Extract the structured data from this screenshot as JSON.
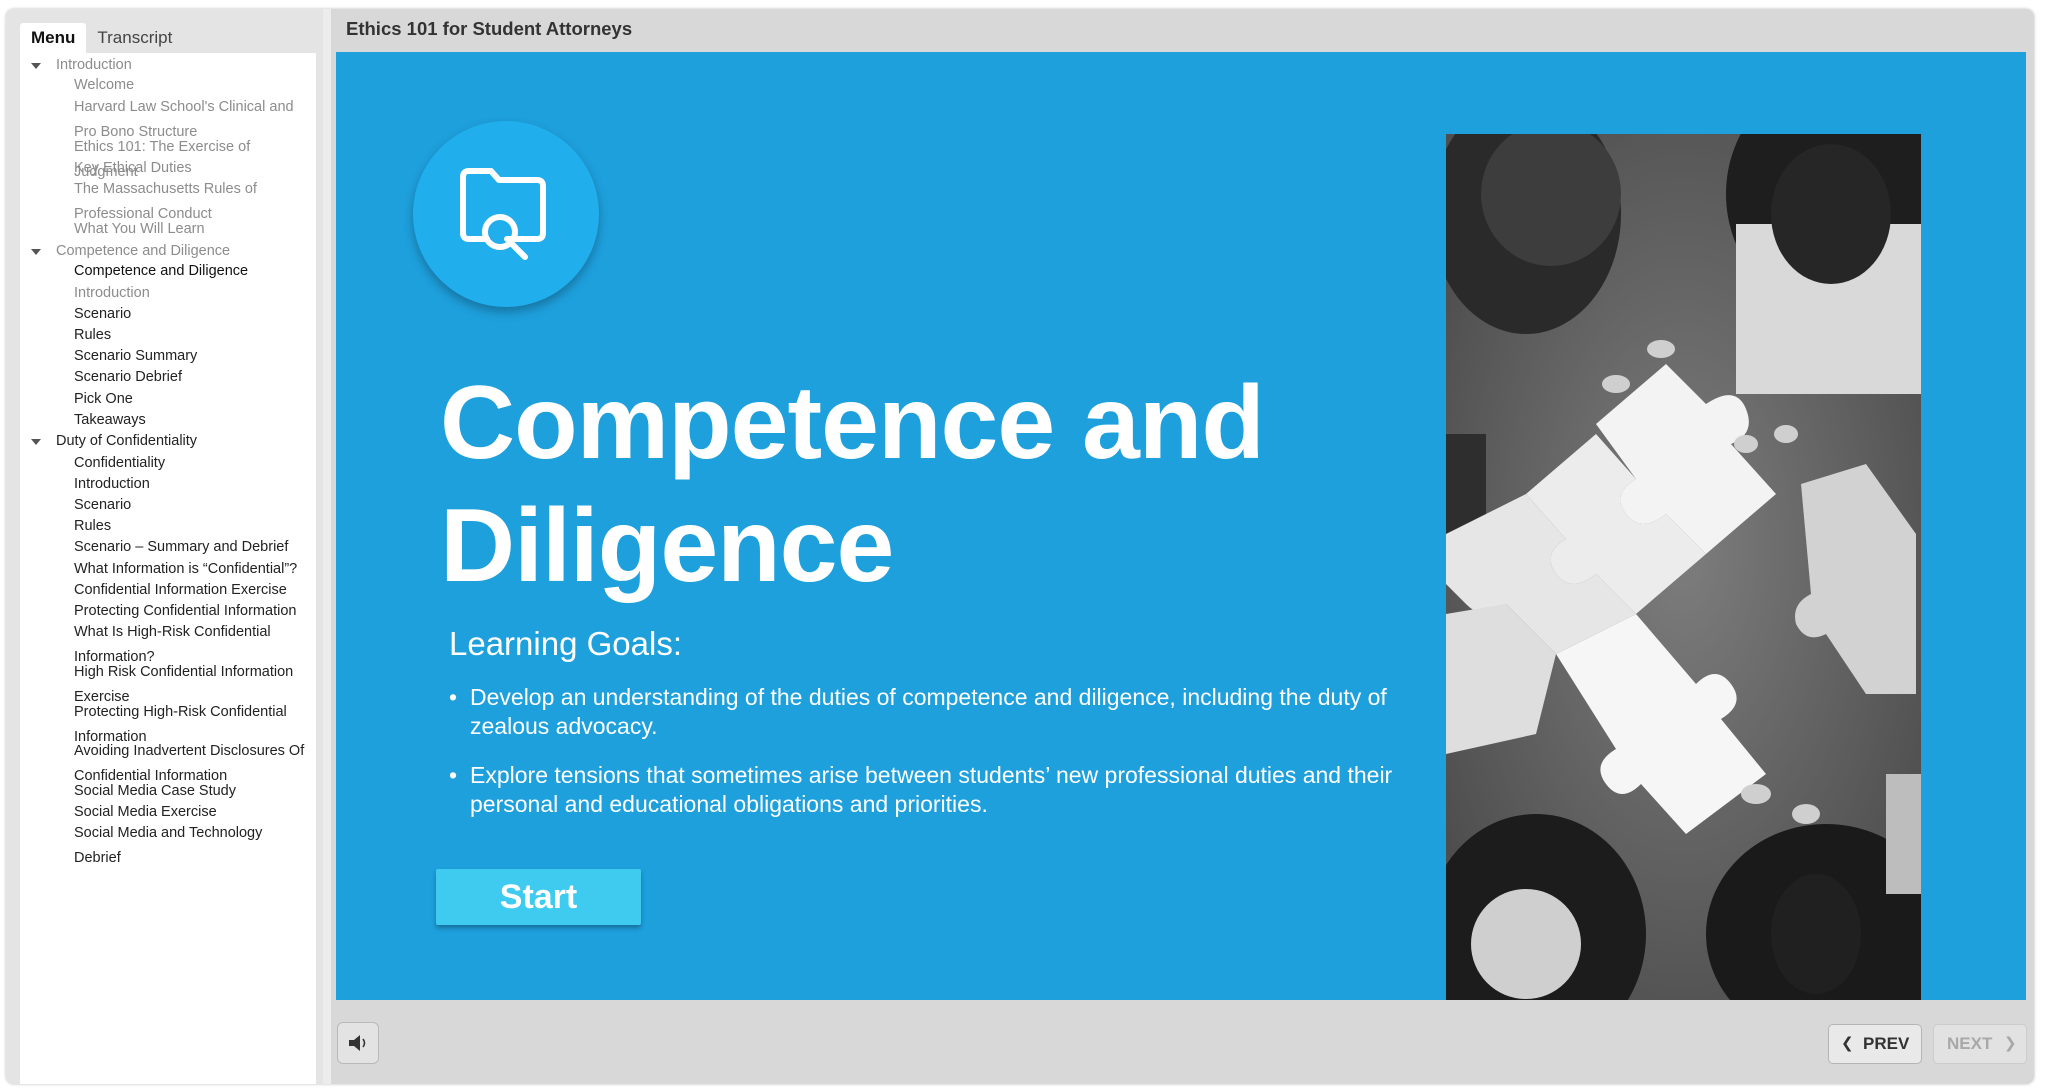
{
  "sidebar": {
    "tabs": [
      {
        "label": "Menu",
        "active": true
      },
      {
        "label": "Transcript",
        "active": false
      }
    ],
    "items": [
      {
        "label": "Introduction",
        "type": "section",
        "dim": true
      },
      {
        "label": "Welcome",
        "type": "item",
        "dim": true
      },
      {
        "label": "Harvard Law School's Clinical and Pro Bono Structure",
        "type": "item",
        "dim": true
      },
      {
        "label": "Ethics 101: The Exercise of Judgment",
        "type": "item",
        "dim": true
      },
      {
        "label": "Key Ethical Duties",
        "type": "item",
        "dim": true
      },
      {
        "label": "The Massachusetts Rules of Professional Conduct",
        "type": "item",
        "dim": true
      },
      {
        "label": "What You Will Learn",
        "type": "item",
        "dim": true
      },
      {
        "label": "Competence and Diligence",
        "type": "section",
        "dim": true
      },
      {
        "label": "Competence and Diligence",
        "type": "item",
        "selected": true
      },
      {
        "label": "Introduction",
        "type": "item",
        "dim": true
      },
      {
        "label": "Scenario",
        "type": "item"
      },
      {
        "label": "Rules",
        "type": "item"
      },
      {
        "label": "Scenario Summary",
        "type": "item"
      },
      {
        "label": "Scenario Debrief",
        "type": "item"
      },
      {
        "label": "Pick One",
        "type": "item"
      },
      {
        "label": "Takeaways",
        "type": "item"
      },
      {
        "label": "Duty of Confidentiality",
        "type": "section"
      },
      {
        "label": "Confidentiality",
        "type": "item"
      },
      {
        "label": "Introduction",
        "type": "item"
      },
      {
        "label": "Scenario",
        "type": "item"
      },
      {
        "label": "Rules",
        "type": "item"
      },
      {
        "label": "Scenario – Summary and Debrief",
        "type": "item"
      },
      {
        "label": "What Information is “Confidential”?",
        "type": "item"
      },
      {
        "label": "Confidential Information Exercise",
        "type": "item"
      },
      {
        "label": "Protecting Confidential Information",
        "type": "item"
      },
      {
        "label": "What Is High-Risk Confidential Information?",
        "type": "item"
      },
      {
        "label": "High Risk Confidential Information Exercise",
        "type": "item"
      },
      {
        "label": "Protecting High-Risk Confidential Information",
        "type": "item"
      },
      {
        "label": "Avoiding Inadvertent Disclosures Of Confidential Information",
        "type": "item"
      },
      {
        "label": "Social Media Case Study",
        "type": "item"
      },
      {
        "label": "Social Media Exercise",
        "type": "item"
      },
      {
        "label": "Social Media and Technology Debrief",
        "type": "item"
      }
    ]
  },
  "header": {
    "course_title": "Ethics 101 for Student Attorneys"
  },
  "slide": {
    "icon": "folder-search-icon",
    "title": "Competence and Diligence",
    "goals_heading": "Learning Goals:",
    "goals": [
      "Develop an understanding of the  duties of competence and diligence, including the duty of zealous advocacy.",
      "Explore tensions that sometimes arise between students’ new professional duties and their personal and educational obligations and priorities."
    ],
    "start_label": "Start",
    "photo": "people-assembling-puzzle-pieces-photo",
    "colors": {
      "background": "#1ea0dd",
      "button": "#3ecbef"
    }
  },
  "controls": {
    "audio_icon": "speaker-icon",
    "prev_label": "PREV",
    "next_label": "NEXT",
    "next_enabled": false
  }
}
